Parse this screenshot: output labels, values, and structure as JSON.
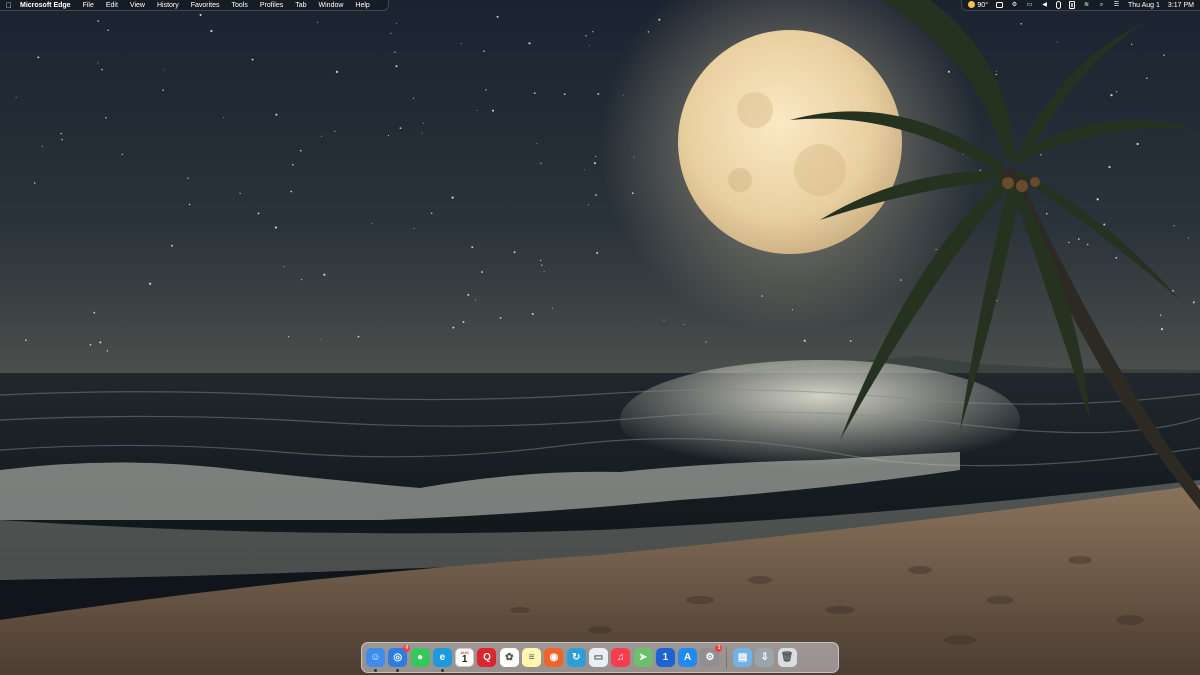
{
  "menubar": {
    "app_name": "Microsoft Edge",
    "menus": [
      "File",
      "Edit",
      "View",
      "History",
      "Favorites",
      "Tools",
      "Profiles",
      "Tab",
      "Window",
      "Help"
    ],
    "weather": "90°",
    "date": "Thu Aug 1",
    "time": "3:17 PM"
  },
  "dock": {
    "items": [
      {
        "name": "finder",
        "icon": "finder-icon",
        "color": "#3b8ef0",
        "glyph": "☺",
        "running": true
      },
      {
        "name": "safari",
        "icon": "safari-icon",
        "color": "#2a7de1",
        "glyph": "◎",
        "badge": "4",
        "running": true
      },
      {
        "name": "messages",
        "icon": "messages-icon",
        "color": "#34c759",
        "glyph": "●",
        "running": false
      },
      {
        "name": "edge",
        "icon": "edge-icon",
        "color": "#1a9be0",
        "glyph": "e",
        "running": true
      },
      {
        "name": "calendar",
        "icon": "calendar-icon",
        "color": "#ffffff",
        "month": "AUG",
        "day": "1",
        "running": false
      },
      {
        "name": "quip",
        "icon": "quip-icon",
        "color": "#e0242b",
        "glyph": "Q",
        "running": false
      },
      {
        "name": "photos",
        "icon": "photos-icon",
        "color": "#ffffff",
        "glyph": "✿",
        "running": false
      },
      {
        "name": "notes",
        "icon": "notes-icon",
        "color": "#fff6b0",
        "glyph": "≡",
        "running": false
      },
      {
        "name": "app-orange",
        "icon": "orange-app-icon",
        "color": "#f2632a",
        "glyph": "◉",
        "running": false
      },
      {
        "name": "app-teal",
        "icon": "teal-app-icon",
        "color": "#2c9fd9",
        "glyph": "↻",
        "running": false
      },
      {
        "name": "preview",
        "icon": "preview-icon",
        "color": "#e8eef5",
        "glyph": "▭",
        "running": false
      },
      {
        "name": "music",
        "icon": "music-icon",
        "color": "#fa3c4c",
        "glyph": "♫",
        "running": false
      },
      {
        "name": "maps",
        "icon": "maps-icon",
        "color": "#6dc06a",
        "glyph": "➤",
        "running": false
      },
      {
        "name": "1password",
        "icon": "1password-icon",
        "color": "#1b64d8",
        "glyph": "1",
        "running": false
      },
      {
        "name": "app-store",
        "icon": "app-store-icon",
        "color": "#1e8bf5",
        "glyph": "A",
        "running": false
      },
      {
        "name": "system-settings",
        "icon": "settings-icon",
        "color": "#8e8e93",
        "glyph": "⚙",
        "badge": "1",
        "running": false
      }
    ],
    "extras": [
      {
        "name": "applications-folder",
        "icon": "folder-icon",
        "color": "#6fb3e8",
        "glyph": "▤"
      },
      {
        "name": "downloads-folder",
        "icon": "downloads-icon",
        "color": "#9aa4ad",
        "glyph": "⇩"
      },
      {
        "name": "trash",
        "icon": "trash-icon",
        "color": "#d9dde2",
        "glyph": "🗑"
      }
    ]
  }
}
